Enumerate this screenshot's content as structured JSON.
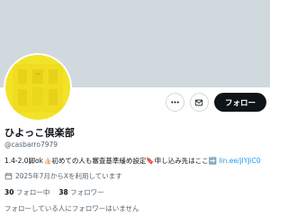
{
  "profile": {
    "name": "ひよっこ倶楽部",
    "handle": "@casbarro7979",
    "bio_before_link": "1.4-2.0脚ok👍🏻初めての人も審査基準緩め設定🔖申し込み先はここ➡️",
    "bio_link": "lin.ee/jIYJiC0",
    "joined": "2025年7月からXを利用しています",
    "following_count": "30",
    "following_label": "フォロー中",
    "followers_count": "38",
    "followers_label": "フォロワー",
    "mutual_text": "フォローしている人にフォロワーはいません"
  },
  "actions": {
    "more_icon": "more-icon",
    "message_icon": "mail-icon",
    "follow_label": "フォロー"
  },
  "colors": {
    "banner": "#cfd9de",
    "avatar_bg": "#f5e52a",
    "link": "#1d9bf0",
    "muted": "#536471",
    "follow_button": "#0f1419"
  }
}
